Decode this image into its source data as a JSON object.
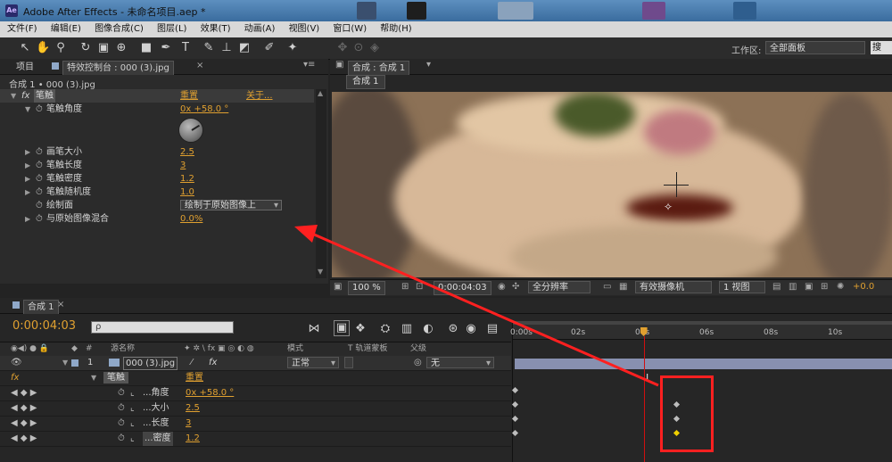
{
  "window": {
    "app_icon": "Ae",
    "title": "Adobe After Effects - 未命名项目.aep *"
  },
  "menu": [
    "文件(F)",
    "编辑(E)",
    "图像合成(C)",
    "图层(L)",
    "效果(T)",
    "动画(A)",
    "视图(V)",
    "窗口(W)",
    "帮助(H)"
  ],
  "toolbar": {
    "workspace_label": "工作区:",
    "workspace_value": "全部面板",
    "search_placeholder": "搜"
  },
  "left_panel": {
    "tab_project": "项目",
    "tab_effects": "特效控制台 : 000 (3).jpg",
    "breadcrumb": "合成 1 • 000 (3).jpg",
    "effect": {
      "fx": "fx",
      "name": "笔触",
      "reset": "重置",
      "about": "关于..."
    },
    "properties": [
      {
        "name": "笔触角度",
        "value": "0x +58.0 °"
      },
      {
        "name": "画笔大小",
        "value": "2.5"
      },
      {
        "name": "笔触长度",
        "value": "3"
      },
      {
        "name": "笔触密度",
        "value": "1.2"
      },
      {
        "name": "笔触随机度",
        "value": "1.0"
      },
      {
        "name": "绘制面",
        "value": "绘制于原始图像上"
      },
      {
        "name": "与原始图像混合",
        "value": "0.0%"
      }
    ]
  },
  "viewer": {
    "tab_label": "合成 : 合成 1",
    "subtab": "合成 1",
    "zoom": "100 %",
    "timecode": "0:00:04:03",
    "resolution": "全分辨率",
    "camera": "有效摄像机",
    "views": "1 视图",
    "exposure": "+0.0"
  },
  "timeline": {
    "tab": "合成 1",
    "timecode": "0:00:04:03",
    "search_placeholder": "ρ",
    "columns": {
      "source_name": "源名称",
      "mode": "模式",
      "trkmat": "T 轨道蒙板",
      "parent": "父级",
      "num": "#"
    },
    "layer": {
      "index": "1",
      "name": "000 (3).jpg",
      "mode": "正常",
      "parent": "无"
    },
    "effect": {
      "fx": "fx",
      "name": "笔触",
      "reset": "重置"
    },
    "props": [
      {
        "label": "...角度",
        "value": "0x +58.0 °"
      },
      {
        "label": "...大小",
        "value": "2.5"
      },
      {
        "label": "...长度",
        "value": "3"
      },
      {
        "label": "...密度",
        "value": "1.2"
      }
    ],
    "ruler": [
      "0:00s",
      "02s",
      "04s",
      "06s",
      "08s",
      "10s"
    ],
    "playhead_seconds": 4.1
  },
  "colors": {
    "accent_orange": "#e0a030",
    "annotation_red": "#ff2020",
    "playhead_red": "#d01010",
    "keyframe_selected": "#f0d000"
  }
}
